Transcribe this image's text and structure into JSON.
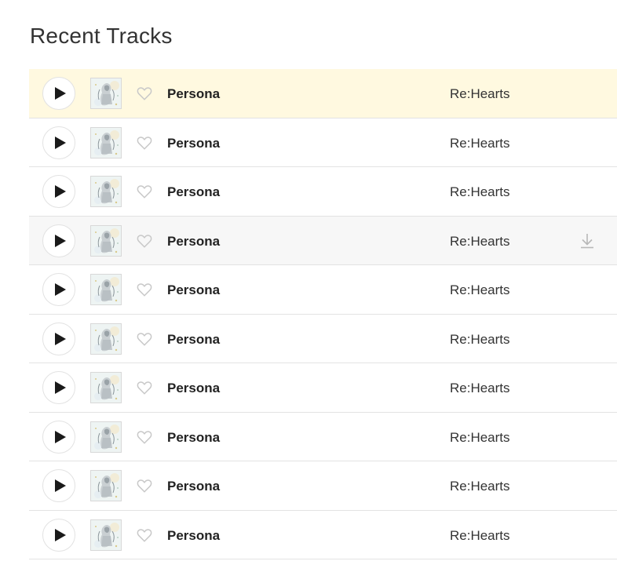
{
  "section": {
    "title": "Recent Tracks"
  },
  "colors": {
    "highlight_row": "#fff9e0",
    "hover_row": "#f7f7f7",
    "heart_outline": "#c8c8c8",
    "download_icon": "#b8b8b8"
  },
  "tracks": [
    {
      "name": "Persona",
      "artist": "Re:Hearts",
      "state": "highlighted"
    },
    {
      "name": "Persona",
      "artist": "Re:Hearts",
      "state": "normal"
    },
    {
      "name": "Persona",
      "artist": "Re:Hearts",
      "state": "normal"
    },
    {
      "name": "Persona",
      "artist": "Re:Hearts",
      "state": "hovered",
      "show_download": true
    },
    {
      "name": "Persona",
      "artist": "Re:Hearts",
      "state": "normal"
    },
    {
      "name": "Persona",
      "artist": "Re:Hearts",
      "state": "normal"
    },
    {
      "name": "Persona",
      "artist": "Re:Hearts",
      "state": "normal"
    },
    {
      "name": "Persona",
      "artist": "Re:Hearts",
      "state": "normal"
    },
    {
      "name": "Persona",
      "artist": "Re:Hearts",
      "state": "normal"
    },
    {
      "name": "Persona",
      "artist": "Re:Hearts",
      "state": "normal"
    }
  ],
  "icons": {
    "play": "play-icon",
    "favorite": "heart-icon",
    "download": "download-icon",
    "cover": "album-cover"
  }
}
